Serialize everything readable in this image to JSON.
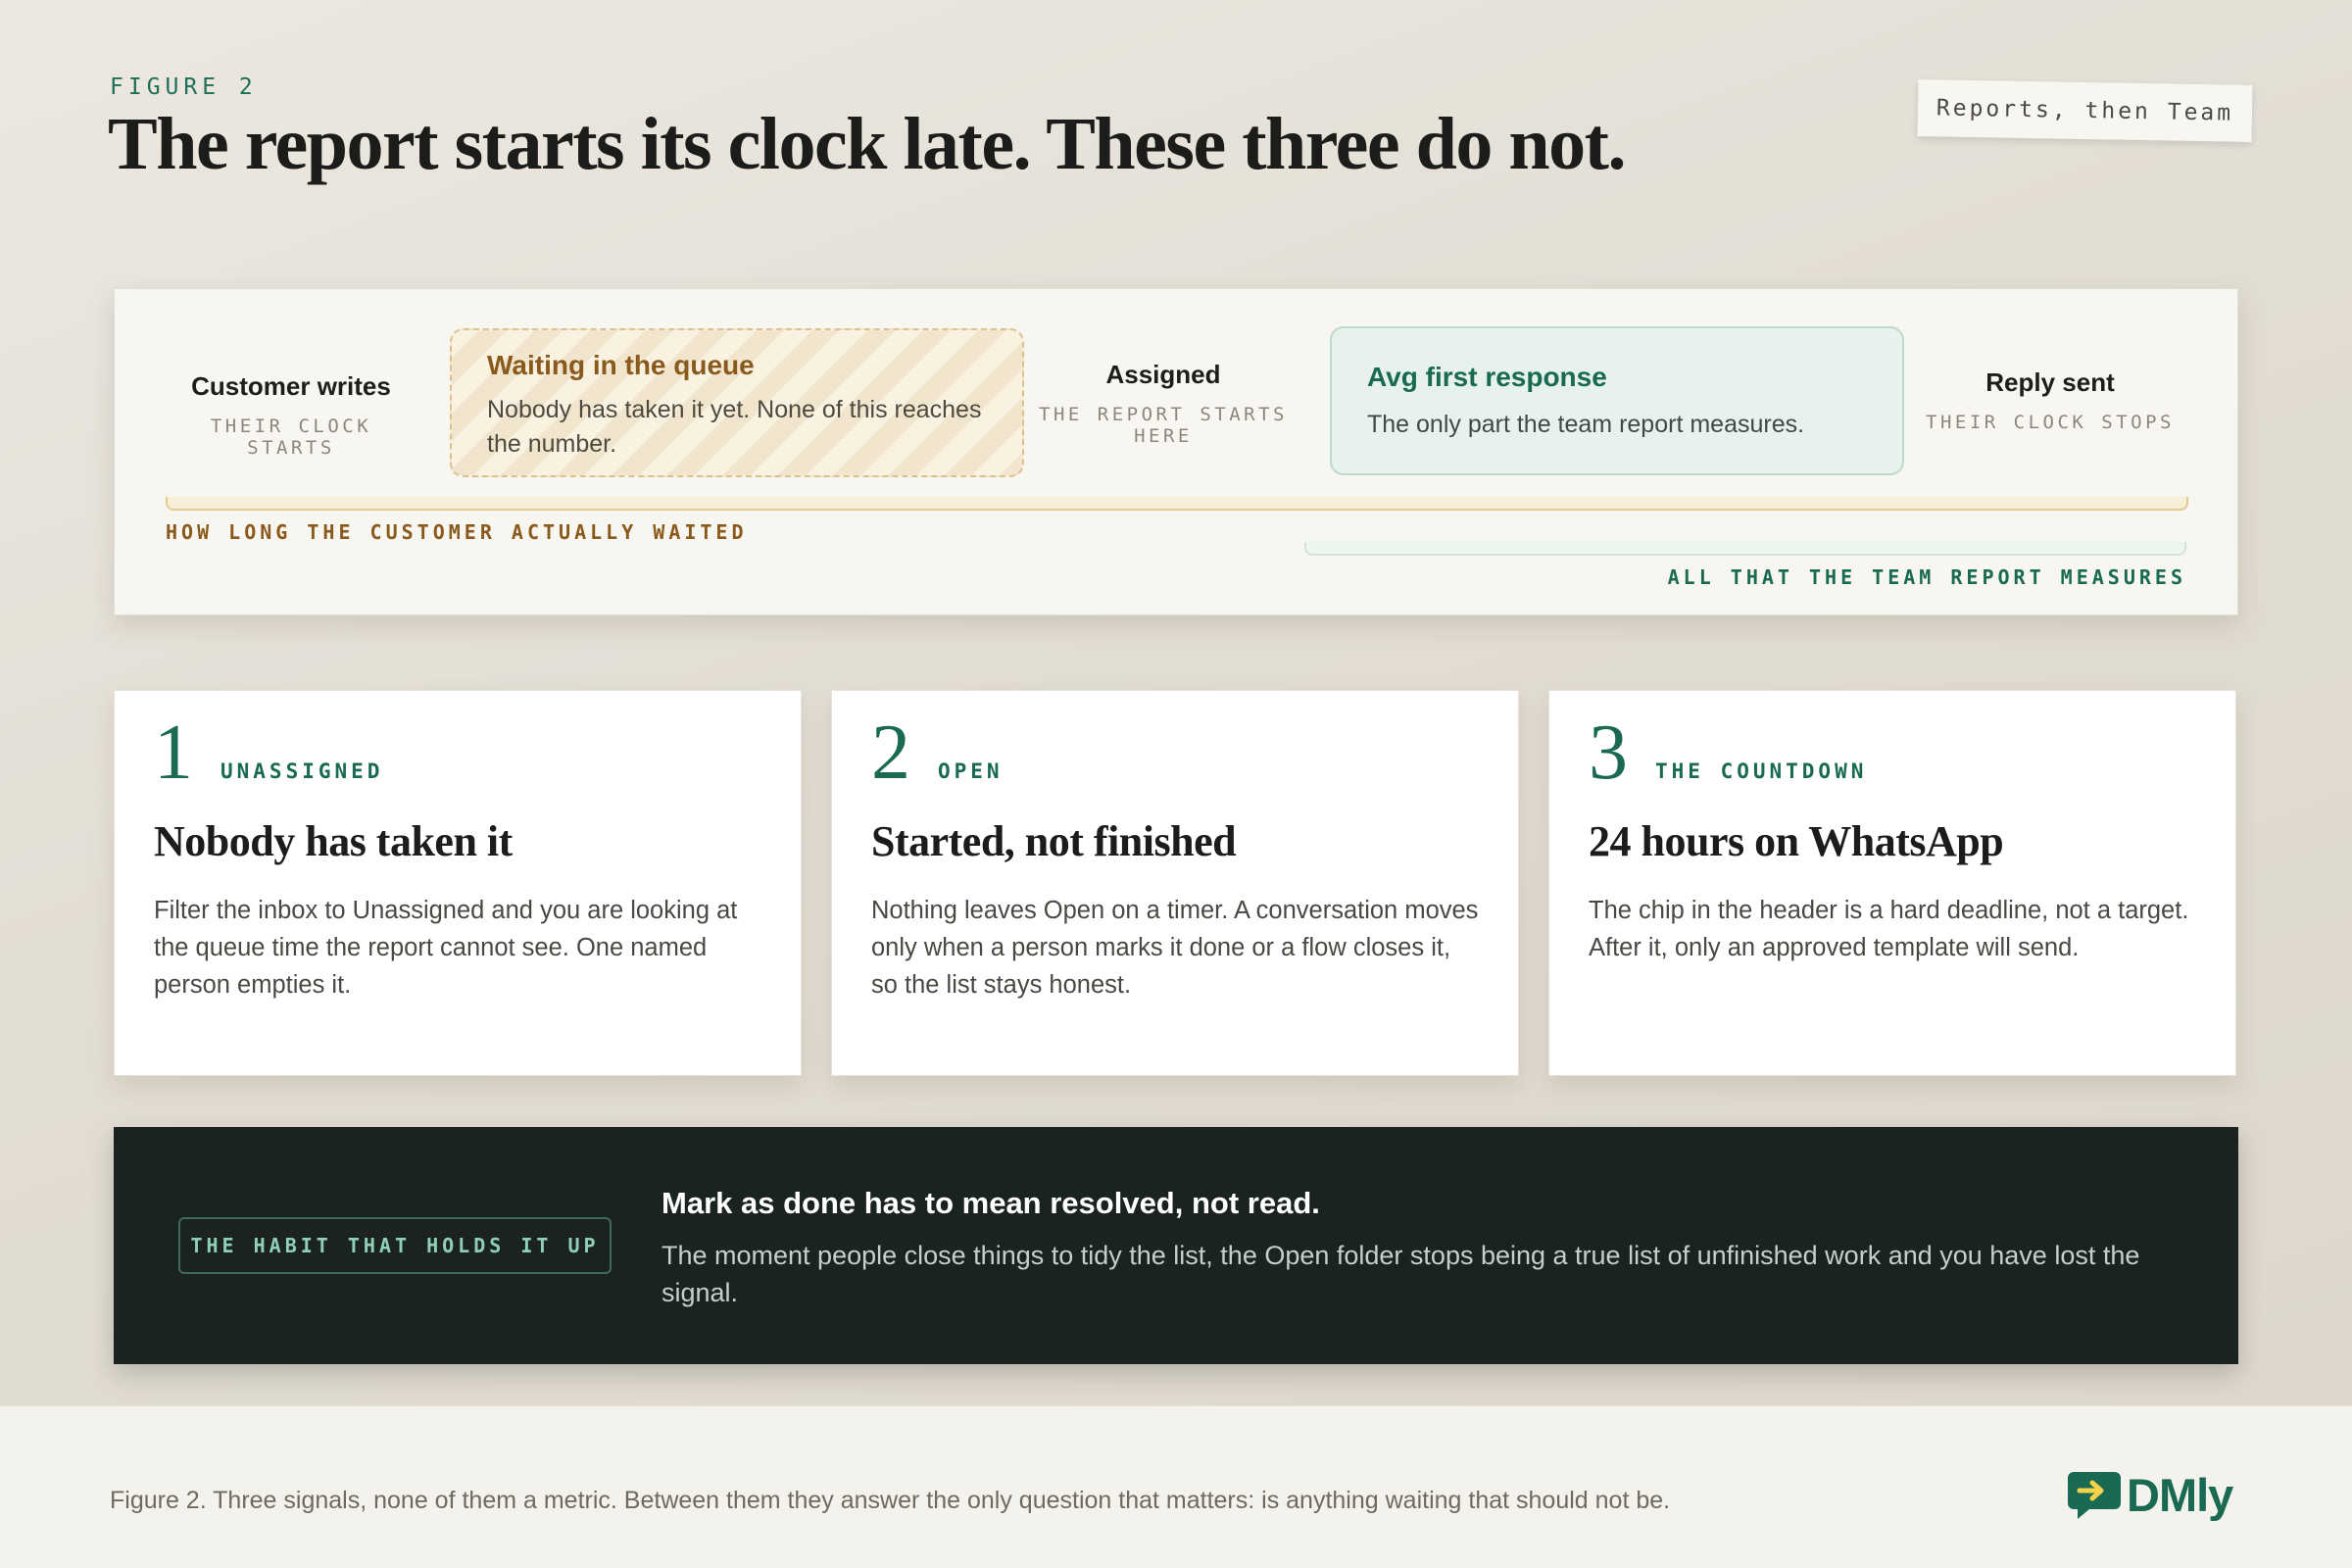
{
  "figure_label": "FIGURE 2",
  "title": "The report starts its clock late. These three do not.",
  "tag": "Reports, then Team",
  "timeline": {
    "customer": {
      "title": "Customer writes",
      "sub": "THEIR CLOCK STARTS"
    },
    "queue": {
      "title": "Waiting in the queue",
      "text": "Nobody has taken it yet. None of this reaches the number."
    },
    "assigned": {
      "title": "Assigned",
      "sub": "THE REPORT STARTS HERE"
    },
    "avg": {
      "title": "Avg first response",
      "text": "The only part the team report measures."
    },
    "reply": {
      "title": "Reply sent",
      "sub": "THEIR CLOCK STOPS"
    },
    "wait_label": "HOW LONG THE CUSTOMER ACTUALLY WAITED",
    "team_label": "ALL THAT THE TEAM REPORT MEASURES"
  },
  "cards": [
    {
      "num": "1",
      "keyword": "UNASSIGNED",
      "title": "Nobody has taken it",
      "text": "Filter the inbox to Unassigned and you are looking at the queue time the report cannot see. One named person empties it."
    },
    {
      "num": "2",
      "keyword": "OPEN",
      "title": "Started, not finished",
      "text": "Nothing leaves Open on a timer. A conversation moves only when a person marks it done or a flow closes it, so the list stays honest."
    },
    {
      "num": "3",
      "keyword": "THE COUNTDOWN",
      "title": "24 hours on WhatsApp",
      "text": "The chip in the header is a hard deadline, not a target. After it, only an approved template will send."
    }
  ],
  "habit": {
    "label": "THE HABIT THAT HOLDS IT UP",
    "title": "Mark as done has to mean resolved, not read.",
    "text": "The moment people close things to tidy the list, the Open folder stops being a true list of unfinished work and you have lost the signal."
  },
  "footer": {
    "caption": "Figure 2. Three signals, none of them a metric. Between them they answer the only question that matters: is anything waiting that should not be.",
    "logo_text": "DMly",
    "logo_icon": "chat-arrow-icon"
  },
  "colors": {
    "accent_green": "#1a6a53",
    "accent_amber": "#8a5a1d",
    "banner_bg": "#1a231f"
  }
}
